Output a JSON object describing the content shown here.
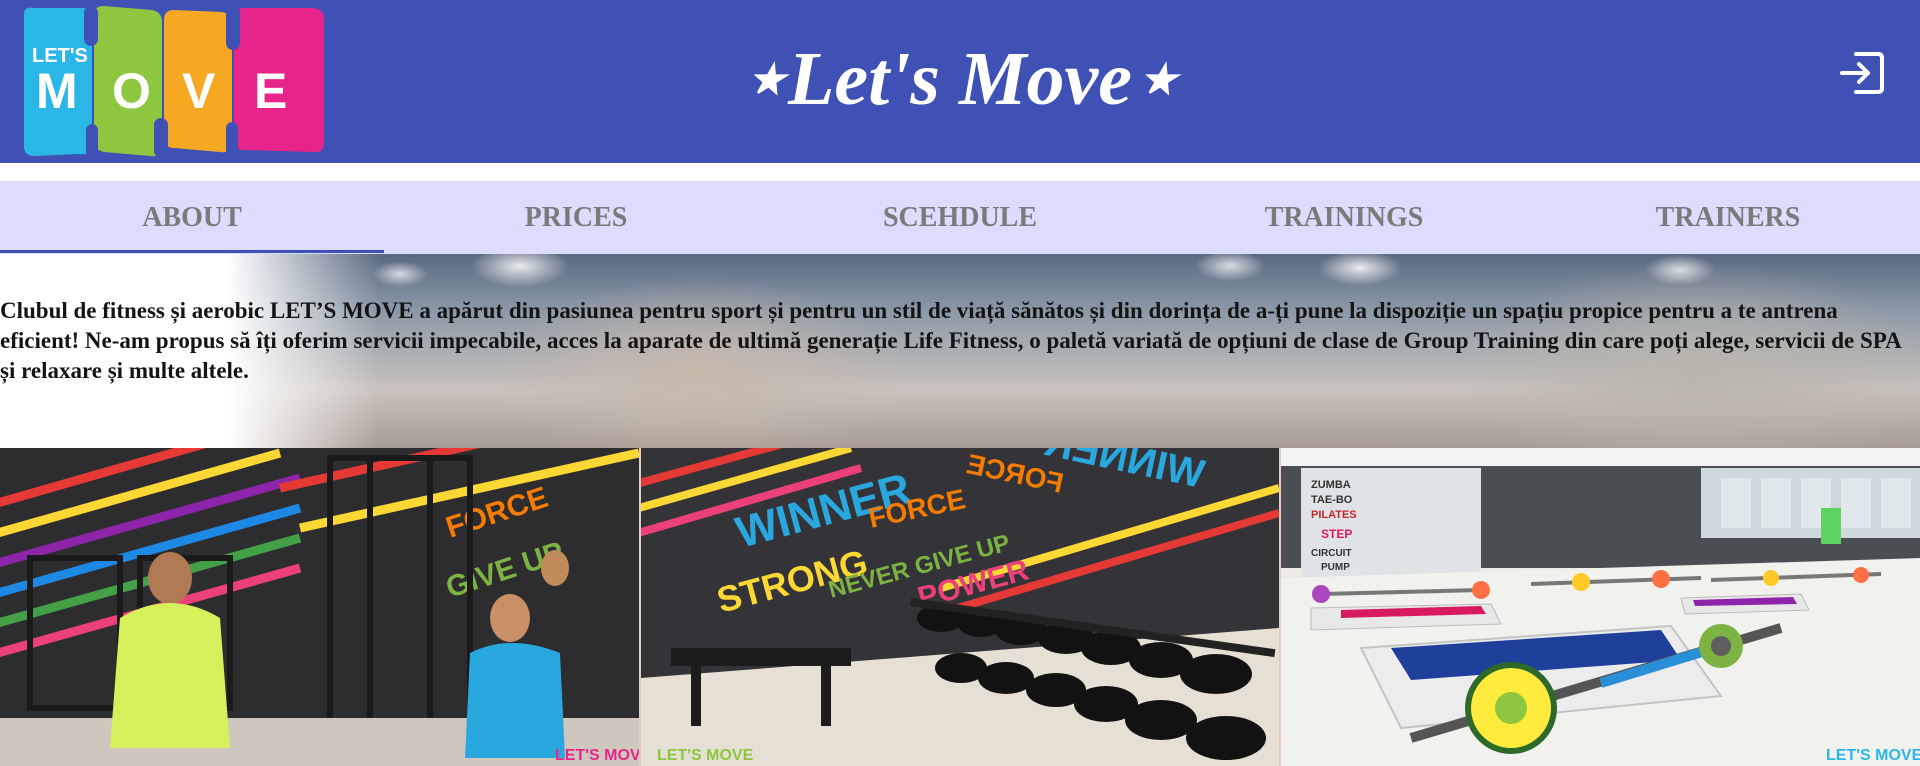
{
  "header": {
    "logo": {
      "top_text": "LET'S",
      "letters": [
        "M",
        "O",
        "V",
        "E"
      ]
    },
    "title": "⋆Let's Move⋆",
    "logout_icon": "sign-out-icon"
  },
  "nav": {
    "items": [
      {
        "label": "ABOUT",
        "active": true
      },
      {
        "label": "PRICES",
        "active": false
      },
      {
        "label": "SCEHDULE",
        "active": false
      },
      {
        "label": "TRAININGS",
        "active": false
      },
      {
        "label": "TRAINERS",
        "active": false
      }
    ]
  },
  "hero": {
    "text": "Clubul de fitness și aerobic LET’S MOVE a apărut din pasiunea pentru sport și pentru un stil de viață sănătos și din dorința de a-ți pune la dispoziție un spațiu propice pentru a te antrena eficient! Ne-am propus să îți oferim servicii impecabile, acces la aparate de ultimă generație Life Fitness, o paletă variată de opțiuni de clase de Group Training din care poți alege, servicii de SPA și relaxare și multe altele."
  },
  "gallery": {
    "photos": [
      {
        "subject": "gym machines with trainers",
        "wall_words": [
          "FORCE",
          "GIVE UP"
        ]
      },
      {
        "subject": "dumbbell rack",
        "wall_words": [
          "WINNER",
          "FORCE",
          "STRONG",
          "NEVER GIVE UP",
          "POWER",
          "WINNER",
          "FORCE"
        ]
      },
      {
        "subject": "group training studio",
        "wall_words": [
          "ZUMBA",
          "TAE-BO",
          "PILATES",
          "STEP",
          "CIRCUIT",
          "PUMP"
        ]
      }
    ],
    "watermark": "LET'S MOVE"
  },
  "colors": {
    "header_bg": "#3f51b5",
    "nav_bg": "#dcdcfe",
    "nav_text": "#7a7a7a",
    "logo_colors": [
      "#2bb6e8",
      "#8dc63f",
      "#f7a823",
      "#e6248a"
    ]
  }
}
